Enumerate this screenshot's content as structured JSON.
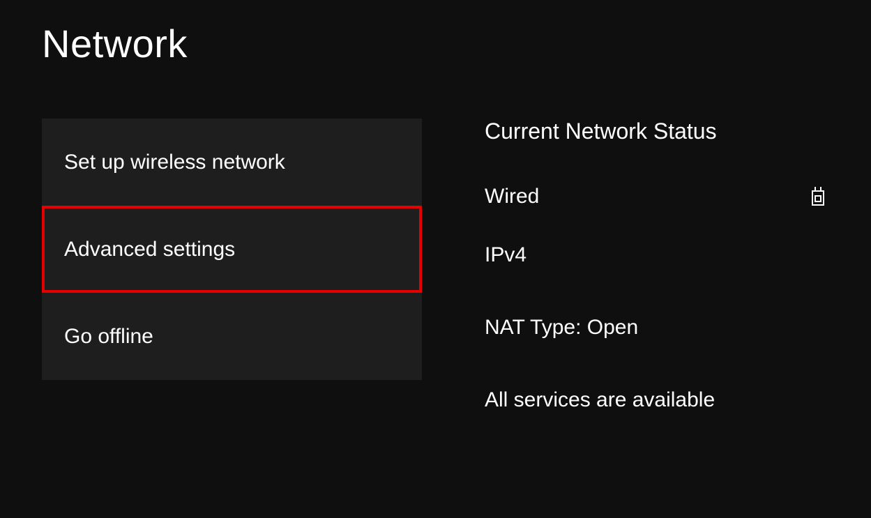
{
  "page": {
    "title": "Network"
  },
  "menu": {
    "items": [
      {
        "label": "Set up wireless network",
        "highlighted": false
      },
      {
        "label": "Advanced settings",
        "highlighted": true
      },
      {
        "label": "Go offline",
        "highlighted": false
      }
    ]
  },
  "status": {
    "heading": "Current Network Status",
    "connection_type": "Wired",
    "ip_version": "IPv4",
    "nat": "NAT Type: Open",
    "services": "All services are available",
    "icon": "ethernet-plug-icon"
  },
  "colors": {
    "highlight": "#e60000",
    "background": "#0f0f0f",
    "tile": "#1e1e1e"
  }
}
